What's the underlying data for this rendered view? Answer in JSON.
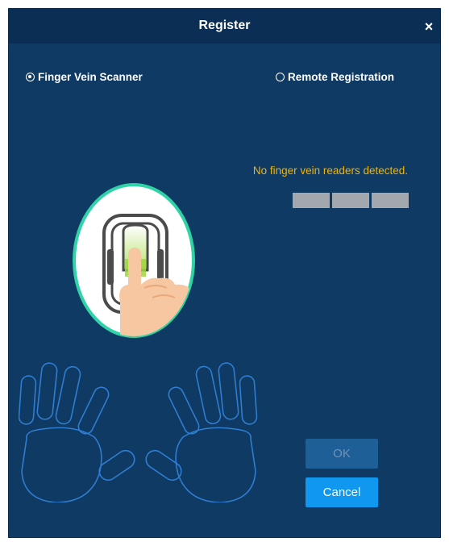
{
  "dialog": {
    "title": "Register",
    "close_label": "×"
  },
  "modes": [
    {
      "label": "Finger Vein Scanner",
      "checked": true
    },
    {
      "label": "Remote Registration",
      "checked": false
    }
  ],
  "status": {
    "message": "No finger vein readers detected.",
    "progress_segments": 3,
    "progress_filled": 0
  },
  "buttons": {
    "ok_label": "OK",
    "ok_enabled": false,
    "cancel_label": "Cancel"
  },
  "colors": {
    "dialog_bg": "#0f3a63",
    "titlebar_bg": "#0b2f54",
    "status_text": "#f2b300",
    "scanner_ring": "#2fd3a6",
    "cancel_bg": "#1098f0",
    "ok_disabled_bg": "#1f5f97",
    "hand_outline": "#2f7dd1"
  },
  "icons": {
    "close": "close-icon",
    "scanner": "finger-vein-scanner-illustration",
    "hands": "hand-outlines-icon"
  }
}
